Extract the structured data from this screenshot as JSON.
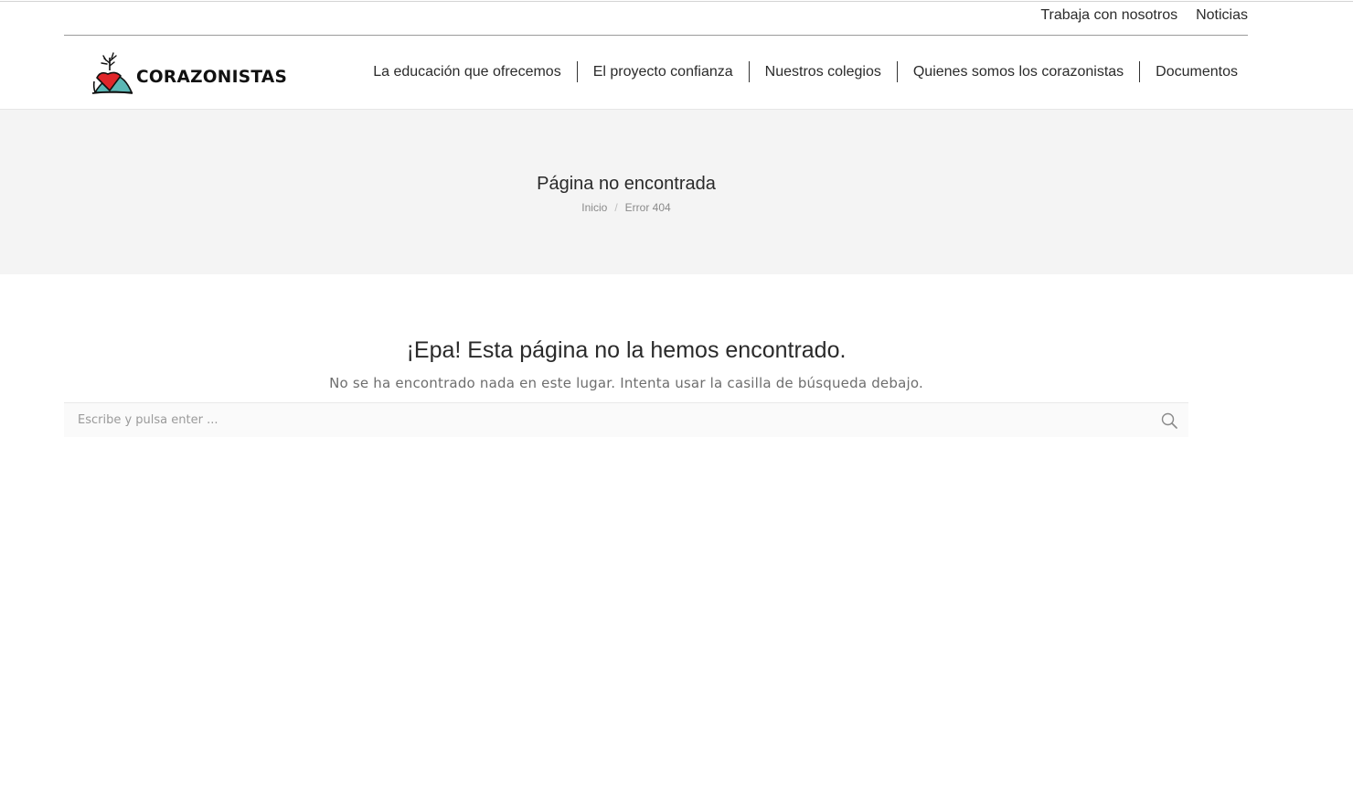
{
  "topbar": {
    "links": [
      {
        "label": "Trabaja con nosotros"
      },
      {
        "label": "Noticias"
      }
    ]
  },
  "header": {
    "logo_text": "CORAZONISTAS",
    "nav": [
      {
        "label": "La educación que ofrecemos"
      },
      {
        "label": "El proyecto confianza"
      },
      {
        "label": "Nuestros colegios"
      },
      {
        "label": "Quienes somos los corazonistas"
      },
      {
        "label": "Documentos"
      }
    ]
  },
  "titlebar": {
    "title": "Página no encontrada",
    "breadcrumb": {
      "home": "Inicio",
      "separator": "/",
      "current": "Error 404"
    }
  },
  "main": {
    "heading": "¡Epa! Esta página no la hemos encontrado.",
    "subtext": "No se ha encontrado nada en este lugar. Intenta usar la casilla de búsqueda debajo.",
    "search": {
      "placeholder": "Escribe y pulsa enter ...",
      "value": ""
    }
  },
  "colors": {
    "logo_red": "#e0262a",
    "logo_teal": "#5bb7b5",
    "title_bg": "#f4f4f4"
  },
  "icons": {
    "search": "magnifier-icon",
    "logo": "heart-mountain-logo"
  }
}
